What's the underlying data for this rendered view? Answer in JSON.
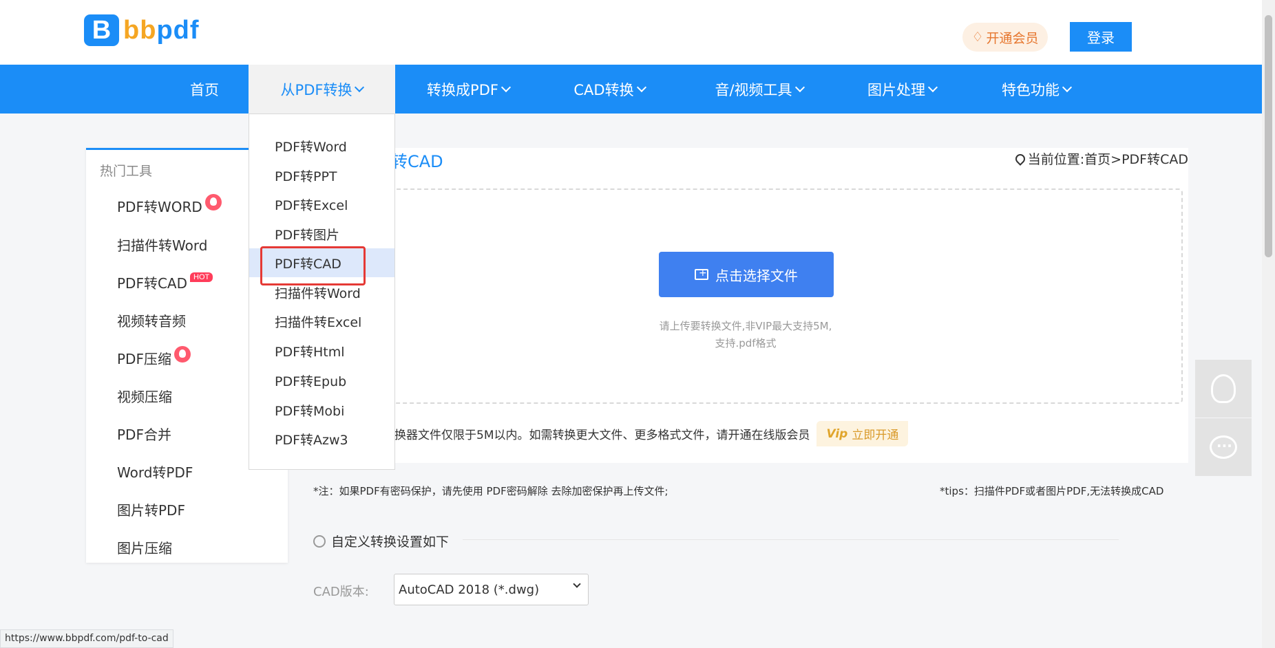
{
  "header": {
    "logo_badge": "B",
    "logo_text_b": "bb",
    "logo_text_rest": "pdf",
    "vip_label": "开通会员",
    "login_label": "登录"
  },
  "nav": {
    "items": [
      {
        "label": "首页"
      },
      {
        "label": "从PDF转换"
      },
      {
        "label": "转换成PDF"
      },
      {
        "label": "CAD转换"
      },
      {
        "label": "音/视频工具"
      },
      {
        "label": "图片处理"
      },
      {
        "label": "特色功能"
      }
    ]
  },
  "sidebar": {
    "title": "热门工具",
    "items": [
      {
        "label": "PDF转WORD",
        "badge": "fire"
      },
      {
        "label": "扫描件转Word"
      },
      {
        "label": "PDF转CAD",
        "badge": "HOT"
      },
      {
        "label": "视频转音频"
      },
      {
        "label": "PDF压缩",
        "badge": "fire"
      },
      {
        "label": "视频压缩"
      },
      {
        "label": "PDF合并"
      },
      {
        "label": "Word转PDF"
      },
      {
        "label": "图片转PDF"
      },
      {
        "label": "图片压缩"
      }
    ]
  },
  "dropdown": {
    "items": [
      {
        "label": "PDF转Word"
      },
      {
        "label": "PDF转PPT"
      },
      {
        "label": "PDF转Excel"
      },
      {
        "label": "PDF转图片"
      },
      {
        "label": "PDF转CAD"
      },
      {
        "label": "扫描件转Word"
      },
      {
        "label": "扫描件转Excel"
      },
      {
        "label": "PDF转Html"
      },
      {
        "label": "PDF转Epub"
      },
      {
        "label": "PDF转Mobi"
      },
      {
        "label": "PDF转Azw3"
      }
    ],
    "selected_index": 4
  },
  "main": {
    "title_visible": "转CAD",
    "breadcrumb": "当前位置:首页>PDF转CAD",
    "choose_button": "点击选择文件",
    "upload_tip_1": "请上传要转换文件,非VIP最大支持5M,",
    "upload_tip_2": "支持.pdf格式",
    "limit_text": "换器文件仅限于5M以内。如需转换更大文件、更多格式文件，请开通在线版会员",
    "open_now": "立即开通",
    "open_now_icon": "Vip"
  },
  "notes": {
    "left": "*注：如果PDF有密码保护，请先使用 PDF密码解除 去除加密保护再上传文件;",
    "right": "*tips：扫描件PDF或者图片PDF,无法转换成CAD"
  },
  "settings": {
    "heading": "自定义转换设置如下",
    "cad_label": "CAD版本:",
    "cad_value": "AutoCAD 2018  (*.dwg)"
  },
  "status_bar": {
    "url": "https://www.bbpdf.com/pdf-to-cad"
  },
  "colors": {
    "brand_blue": "#1b8df7",
    "button_blue": "#3f80f0",
    "hot_red": "#ff3d5a",
    "highlight_red": "#e53935"
  }
}
